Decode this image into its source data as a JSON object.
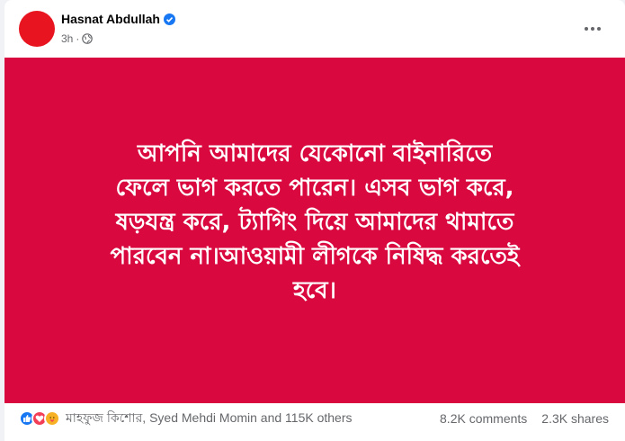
{
  "post": {
    "author": "Hasnat Abdullah",
    "time": "3h",
    "separator": "·",
    "content_lines": [
      "আপনি আমাদের যেকোনো বাইনারিতে",
      "ফেলে ভাগ করতে পারেন। এসব ভাগ করে,",
      "ষড়যন্ত্র করে, ট্যাগিং দিয়ে আমাদের থামাতে",
      "পারবেন না।আওয়ামী লীগকে নিষিদ্ধ করতেই",
      "হবে।"
    ],
    "image_background": "#d9083f",
    "avatar_color": "#e8141f"
  },
  "footer": {
    "reaction_names": "মাহফুজ কিশোর, Syed Mehdi Momin and 115K others",
    "comments": "8.2K comments",
    "shares": "2.3K shares",
    "reactions": [
      "like-icon",
      "love-icon",
      "care-icon"
    ]
  }
}
